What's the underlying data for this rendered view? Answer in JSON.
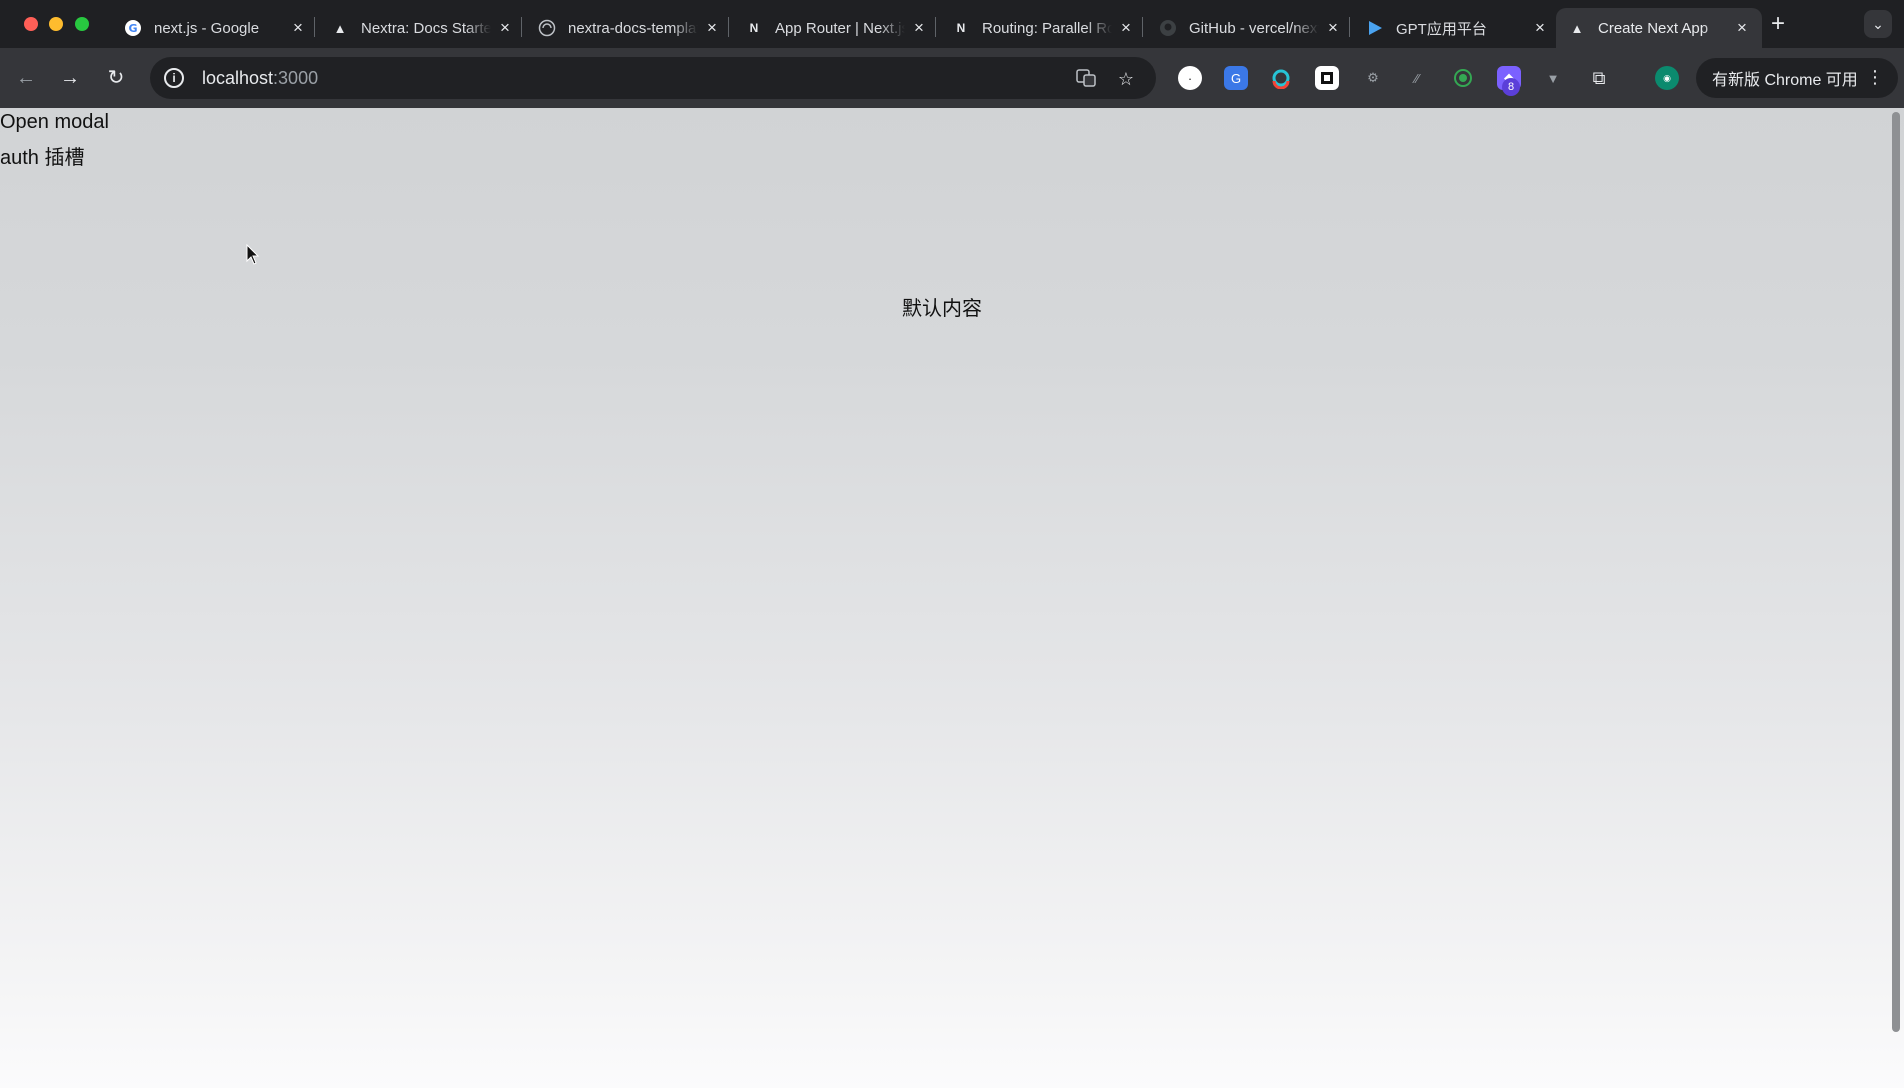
{
  "browser": {
    "tabs": [
      {
        "title": "next.js - Google",
        "favicon": "google-icon"
      },
      {
        "title": "Nextra: Docs Starter",
        "favicon": "nextra-triangle-icon"
      },
      {
        "title": "nextra-docs-template",
        "favicon": "vercel-globe-icon"
      },
      {
        "title": "App Router | Next.js",
        "favicon": "nextjs-icon"
      },
      {
        "title": "Routing: Parallel Routes",
        "favicon": "nextjs-icon"
      },
      {
        "title": "GitHub - vercel/next.js",
        "favicon": "github-icon"
      },
      {
        "title": "GPT应用平台",
        "favicon": "play-icon"
      },
      {
        "title": "Create Next App",
        "favicon": "vercel-triangle-icon",
        "active": true
      }
    ],
    "address": {
      "host": "localhost",
      "port": ":3000"
    },
    "update_button": "有新版 Chrome 可用",
    "extension_badge": "8",
    "colors": {
      "accent": "#35363a",
      "tab_strip": "#1f2023"
    }
  },
  "page": {
    "open_modal": "Open modal",
    "auth_slot": "auth 插槽",
    "default_content": "默认内容"
  }
}
